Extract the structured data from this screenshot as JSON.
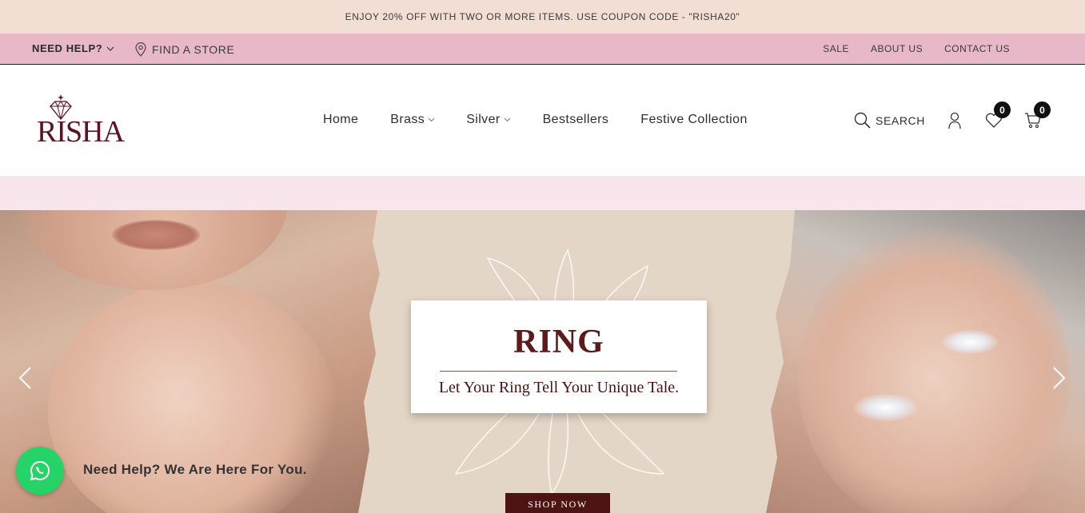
{
  "announcement": "ENJOY 20% OFF WITH TWO OR MORE ITEMS. USE COUPON CODE - \"RISHA20\"",
  "utility": {
    "need_help": "NEED HELP?",
    "find_store": "FIND A STORE",
    "links": [
      "SALE",
      "ABOUT US",
      "CONTACT US"
    ]
  },
  "brand": {
    "logo_text": "RISHA",
    "color": "#5c1220"
  },
  "nav": {
    "items": [
      {
        "label": "Home",
        "has_dropdown": false
      },
      {
        "label": "Brass",
        "has_dropdown": true
      },
      {
        "label": "Silver",
        "has_dropdown": true
      },
      {
        "label": "Bestsellers",
        "has_dropdown": false
      },
      {
        "label": "Festive Collection",
        "has_dropdown": false
      }
    ]
  },
  "header_actions": {
    "search_label": "SEARCH",
    "wishlist_count": "0",
    "cart_count": "0"
  },
  "hero": {
    "title": "RING",
    "subtitle": "Let Your Ring Tell Your Unique Tale.",
    "cta": "SHOP NOW"
  },
  "whatsapp": {
    "text": "Need Help? We Are Here For You."
  },
  "colors": {
    "announcement_bg": "#f3ded4",
    "utility_bg": "#e8b7c8",
    "strip_bg": "#f8e6ec",
    "accent_maroon": "#4e1313",
    "whatsapp_green": "#25d366"
  }
}
